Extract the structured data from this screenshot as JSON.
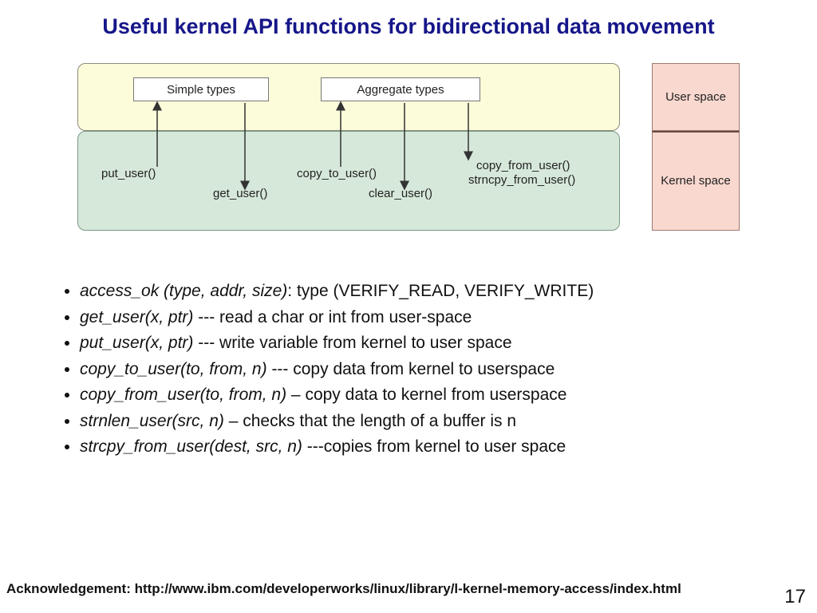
{
  "title": "Useful kernel API functions for bidirectional data movement",
  "diagram": {
    "simple_types": "Simple types",
    "aggregate_types": "Aggregate types",
    "put_user": "put_user()",
    "get_user": "get_user()",
    "copy_to_user": "copy_to_user()",
    "clear_user": "clear_user()",
    "copy_from_user": "copy_from_user()",
    "strncpy_from_user": "strncpy_from_user()",
    "user_space": "User\nspace",
    "kernel_space": "Kernel\nspace"
  },
  "bullets": [
    {
      "fn": "access_ok (type, addr, size)",
      "sep": ":  ",
      "desc": "type (VERIFY_READ, VERIFY_WRITE)"
    },
    {
      "fn": "get_user(x, ptr)",
      "sep": " --- ",
      "desc": "read a char or int from user-space"
    },
    {
      "fn": "put_user(x, ptr)",
      "sep": " --- ",
      "desc": "write variable from kernel to user space"
    },
    {
      "fn": "copy_to_user(to, from, n)",
      "sep": " --- ",
      "desc": "copy data from kernel to userspace"
    },
    {
      "fn": "copy_from_user(to, from, n)",
      "sep": " – ",
      "desc": "copy data to kernel from userspace"
    },
    {
      "fn": "strnlen_user(src, n)",
      "sep": " – ",
      "desc": "checks that the length of a buffer is n"
    },
    {
      "fn": "strcpy_from_user(dest, src, n)",
      "sep": " ---",
      "desc": "copies from kernel to user space"
    }
  ],
  "ack": "Acknowledgement: http://www.ibm.com/developerworks/linux/library/l-kernel-memory-access/index.html",
  "page": "17"
}
